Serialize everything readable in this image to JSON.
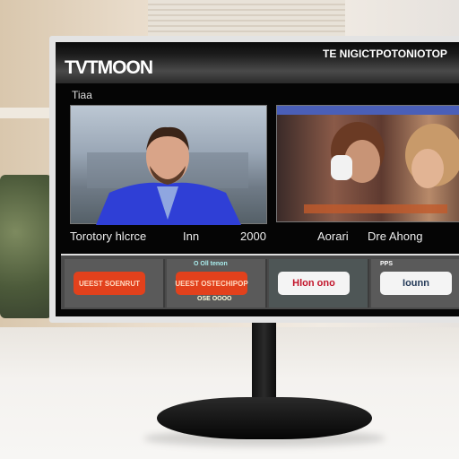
{
  "screen": {
    "logo": "TVTMOON",
    "top_right_text": "TE NIGICTPOTONIOTOP",
    "section_title": "Tiaa",
    "labels": [
      "Torotory hlcrce",
      "Inn",
      "2000",
      "Aorari",
      "Dre Ahong"
    ],
    "tiles": [
      {
        "button": "UEEST SOENRUT",
        "style": "red"
      },
      {
        "header": "O Oll tenon",
        "button": "UEEST OSTECHIPOP",
        "sub": "OSE OOOO",
        "style": "red"
      },
      {
        "button": "Hlon ono",
        "style": "white"
      },
      {
        "header": "PPS",
        "button": "Iounn",
        "style": "white2"
      }
    ]
  }
}
